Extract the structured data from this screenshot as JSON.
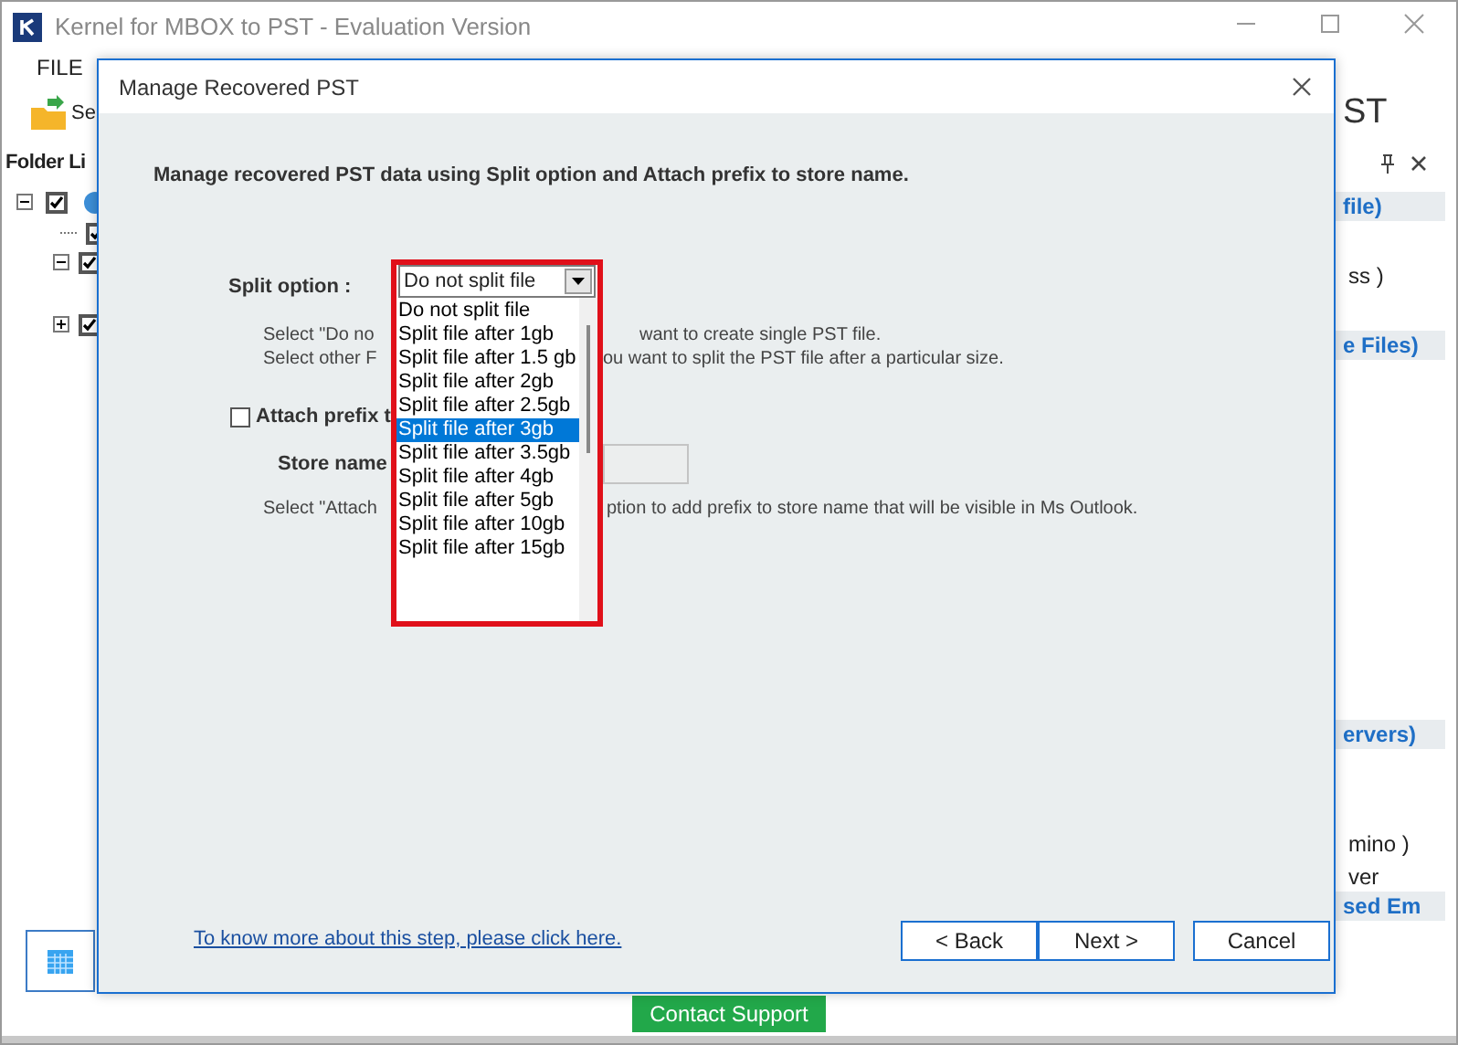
{
  "app_window": {
    "title": "Kernel for MBOX to PST - Evaluation Version",
    "menu": [
      "FILE"
    ],
    "toolbar_button": "Se",
    "heading": "ST",
    "folder_list": {
      "title": "Folder Li",
      "tree": [
        {
          "kind": "node",
          "checked": true,
          "expanded": true,
          "children": [
            {
              "kind": "leaf",
              "checked": true
            },
            {
              "kind": "node",
              "checked": true,
              "expanded": true
            },
            {
              "kind": "node",
              "checked": true,
              "expanded": false
            }
          ]
        }
      ]
    },
    "side_pane": [
      {
        "text": "file)",
        "kind": "group"
      },
      {
        "text": "ss )",
        "kind": "item"
      },
      {
        "text": "e Files)",
        "kind": "group"
      },
      {
        "text": "ervers)",
        "kind": "group"
      },
      {
        "text": "mino )",
        "kind": "item"
      },
      {
        "text": "ver",
        "kind": "item"
      },
      {
        "text": "sed Em",
        "kind": "group"
      }
    ],
    "contact_button": "Contact Support"
  },
  "dialog": {
    "title": "Manage Recovered PST",
    "heading": "Manage recovered PST data using Split option and Attach prefix to store name.",
    "split_label": "Split option :",
    "split_value": "Do not split file",
    "split_hints": [
      {
        "left": "Select \"Do no",
        "right": "want to create single PST file."
      },
      {
        "left": "Select other F",
        "right": "ou want to split the PST file after a particular size."
      }
    ],
    "split_options": [
      {
        "label": "Do not split file",
        "selected": false
      },
      {
        "label": "Split file after 1gb",
        "selected": false
      },
      {
        "label": "Split file after 1.5 gb",
        "selected": false
      },
      {
        "label": "Split file after 2gb",
        "selected": false
      },
      {
        "label": "Split file after 2.5gb",
        "selected": false
      },
      {
        "label": "Split file after 3gb",
        "selected": true
      },
      {
        "label": "Split file after 3.5gb",
        "selected": false
      },
      {
        "label": "Split file after 4gb",
        "selected": false
      },
      {
        "label": "Split file after 5gb",
        "selected": false
      },
      {
        "label": "Split file after 10gb",
        "selected": false
      },
      {
        "label": "Split file after 15gb",
        "selected": false
      }
    ],
    "attach_prefix": {
      "label": "Attach prefix t",
      "checked": false
    },
    "store_name_label": "Store name",
    "store_name_disabled": true,
    "attach_hint": {
      "left": "Select \"Attach",
      "right": "ption to add prefix to store name that will be visible in Ms Outlook."
    },
    "help_link": "To know more about this step, please click here.",
    "buttons": [
      "< Back",
      "Next >",
      "Cancel"
    ]
  }
}
